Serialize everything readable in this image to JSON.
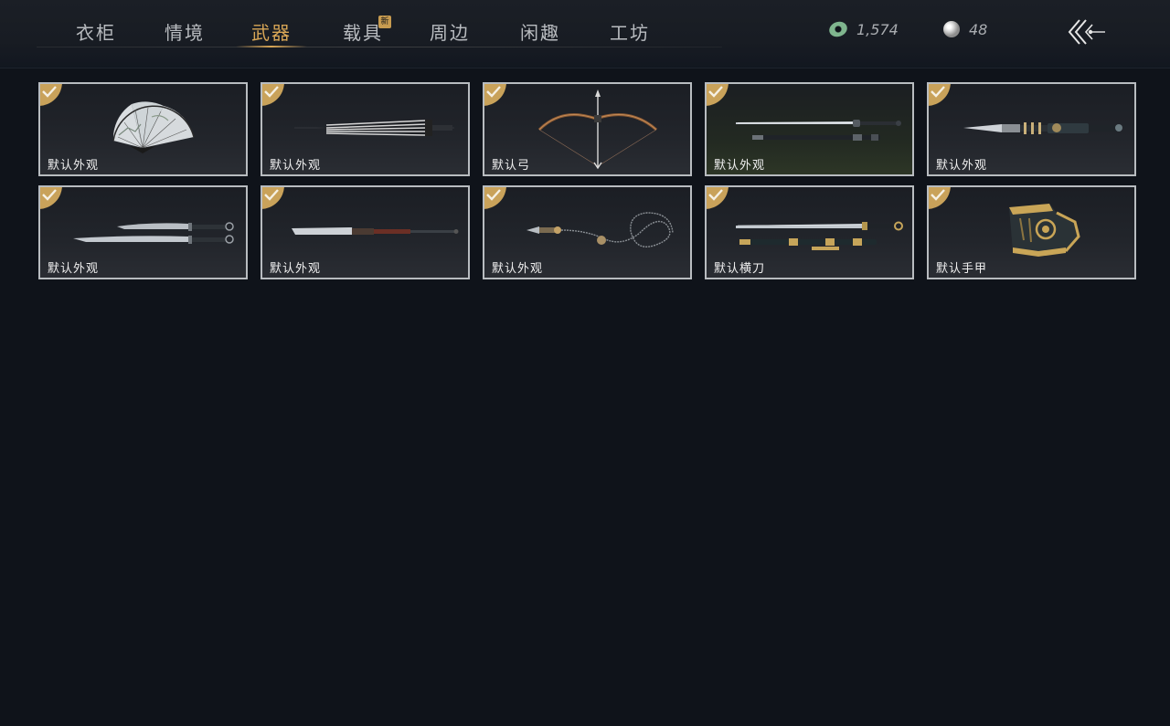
{
  "nav": {
    "tabs": [
      {
        "label": "衣柜"
      },
      {
        "label": "情境"
      },
      {
        "label": "武器"
      },
      {
        "label": "载具"
      },
      {
        "label": "周边"
      },
      {
        "label": "闲趣"
      },
      {
        "label": "工坊"
      }
    ],
    "active_tab": "武器",
    "new_badge": "新"
  },
  "currency": {
    "jade": "1,574",
    "pearl": "48"
  },
  "colors": {
    "accent": "#d8a656",
    "background": "#0f131a",
    "card_border": "#b8bcc0"
  },
  "weapons": [
    {
      "label": "默认外观",
      "icon": "folding-fan-icon",
      "equipped": true
    },
    {
      "label": "默认外观",
      "icon": "umbrella-icon",
      "equipped": true
    },
    {
      "label": "默认弓",
      "icon": "bow-icon",
      "equipped": true
    },
    {
      "label": "默认外观",
      "icon": "sword-icon",
      "equipped": true
    },
    {
      "label": "默认外观",
      "icon": "spear-icon",
      "equipped": true
    },
    {
      "label": "默认外观",
      "icon": "twin-blades-icon",
      "equipped": true
    },
    {
      "label": "默认外观",
      "icon": "glaive-icon",
      "equipped": true
    },
    {
      "label": "默认外观",
      "icon": "rope-dart-icon",
      "equipped": true
    },
    {
      "label": "默认横刀",
      "icon": "hengdao-icon",
      "equipped": true
    },
    {
      "label": "默认手甲",
      "icon": "gauntlet-icon",
      "equipped": true
    }
  ]
}
